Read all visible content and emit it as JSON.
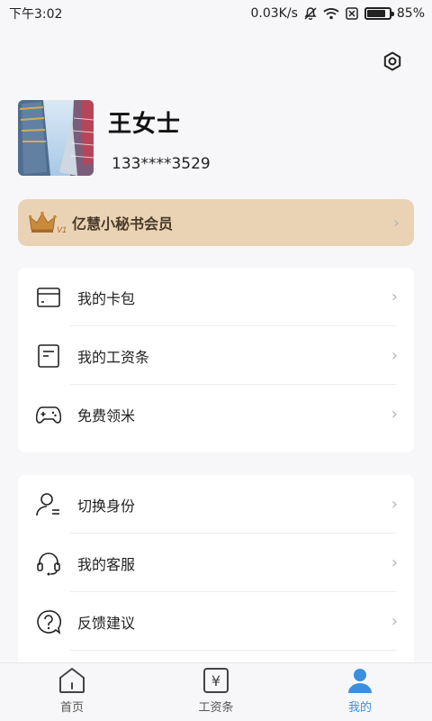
{
  "status_bar": {
    "time": "下午3:02",
    "net_speed": "0.03K/s",
    "battery": "85%",
    "battery_level": 0.85
  },
  "profile": {
    "name": "王女士",
    "phone": "133****3529"
  },
  "vip": {
    "label": "亿慧小秘书会员",
    "badge": "V1"
  },
  "menu1": {
    "items": [
      {
        "label": "我的卡包",
        "icon": "card-icon"
      },
      {
        "label": "我的工资条",
        "icon": "document-icon"
      },
      {
        "label": "免费领米",
        "icon": "gamepad-icon"
      }
    ]
  },
  "menu2": {
    "items": [
      {
        "label": "切换身份",
        "icon": "switch-user-icon"
      },
      {
        "label": "我的客服",
        "icon": "headset-icon"
      },
      {
        "label": "反馈建议",
        "icon": "question-icon"
      }
    ]
  },
  "tabbar": {
    "tabs": [
      {
        "label": "首页",
        "icon": "home-icon"
      },
      {
        "label": "工资条",
        "icon": "payslip-icon"
      },
      {
        "label": "我的",
        "icon": "user-icon"
      }
    ],
    "active": "我的"
  },
  "colors": {
    "accent": "#3b8fe0",
    "vip_bg": "#ead3b4",
    "background": "#f7f7f9"
  }
}
